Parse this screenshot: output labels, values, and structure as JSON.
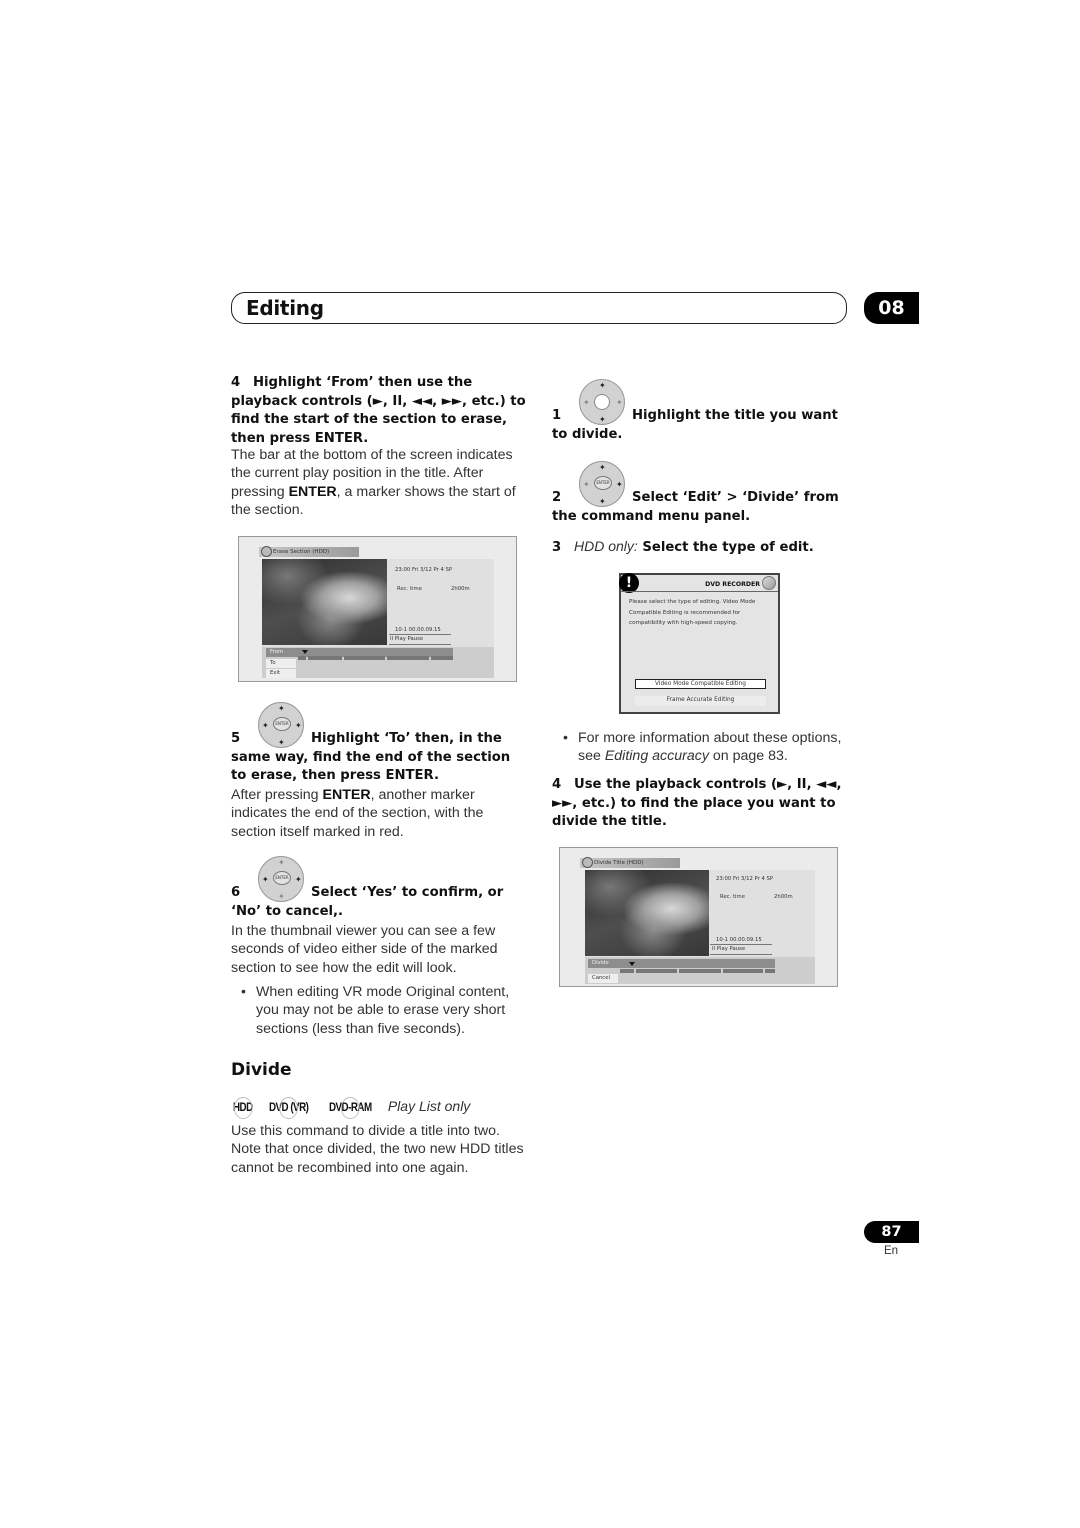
{
  "header": {
    "title": "Editing",
    "chapter": "08"
  },
  "left_column": {
    "step4": {
      "number": "4",
      "heading": "Highlight ‘From’ then use the playback controls (►, II, ◄◄, ►►, etc.) to find the start of the section to erase, then press ENTER.",
      "body_1": "The bar at the bottom of the screen indicates the current play position in the title. After pressing ",
      "body_bold": "ENTER",
      "body_2": ", a marker shows the start of the section."
    },
    "erase_screen": {
      "title": "Erase Section  (HDD)",
      "datetime": "23:00  Fri   3/12  Pr 4    SP",
      "rec_time_label": "Rec. time",
      "rec_time_value": "2h00m",
      "position": "10-1    00.00.09.15",
      "status": "II Play Pause",
      "options": [
        "From",
        "To",
        "Exit"
      ],
      "selected_option": "From"
    },
    "step5": {
      "number": "5",
      "heading": "Highlight ‘To’ then, in the same way, find the end of the section to erase, then press ENTER.",
      "body_1": "After pressing ",
      "body_bold": "ENTER",
      "body_2": ", another marker indicates the end of the section, with the section itself marked in red."
    },
    "step6": {
      "number": "6",
      "heading": "Select ‘Yes’ to confirm, or ‘No’ to cancel,.",
      "body": "In the thumbnail viewer you can see a few seconds of video either side of the marked section to see how the edit will look.",
      "bullet": "When editing VR mode Original content, you may not be able to erase very short sections (less than five seconds)."
    },
    "divide": {
      "heading": "Divide",
      "badges": [
        "HDD",
        "DVD (VR)",
        "DVD-RAM"
      ],
      "badge_note": "Play List only",
      "body": "Use this command to divide a title into two. Note that once divided, the two new HDD titles cannot be recombined into one again."
    }
  },
  "right_column": {
    "step1": {
      "number": "1",
      "heading": "Highlight the title you want to divide."
    },
    "step2": {
      "number": "2",
      "heading": "Select ‘Edit’ > ‘Divide’ from the command menu panel."
    },
    "step3": {
      "number": "3",
      "prefix": "HDD only:",
      "heading": " Select the type of edit."
    },
    "dialog": {
      "brand": "DVD RECORDER",
      "message": "Please select the type of editing. Video Mode Compatible Editing is recommended for compatibility with high-speed copying.",
      "options": [
        "Video Mode Compatible Editing",
        "Frame Accurate Editing"
      ],
      "selected_option": "Video Mode Compatible Editing"
    },
    "bullet_1": "For more information about these options, see ",
    "bullet_link": "Editing accuracy",
    "bullet_2": " on page 83.",
    "step4": {
      "number": "4",
      "heading": "Use the playback controls (►, II, ◄◄, ►►, etc.) to find the place you want to divide the title."
    },
    "divide_screen": {
      "title": "Divide Title  (HDD)",
      "datetime": "23:00  Fri   3/12  Pr 4    SP",
      "rec_time_label": "Rec. time",
      "rec_time_value": "2h00m",
      "position": "10-1    00.00.09.15",
      "status": "II Play Pause",
      "options": [
        "Divide",
        "Cancel"
      ],
      "selected_option": "Divide"
    }
  },
  "footer": {
    "page_number": "87",
    "language": "En"
  }
}
